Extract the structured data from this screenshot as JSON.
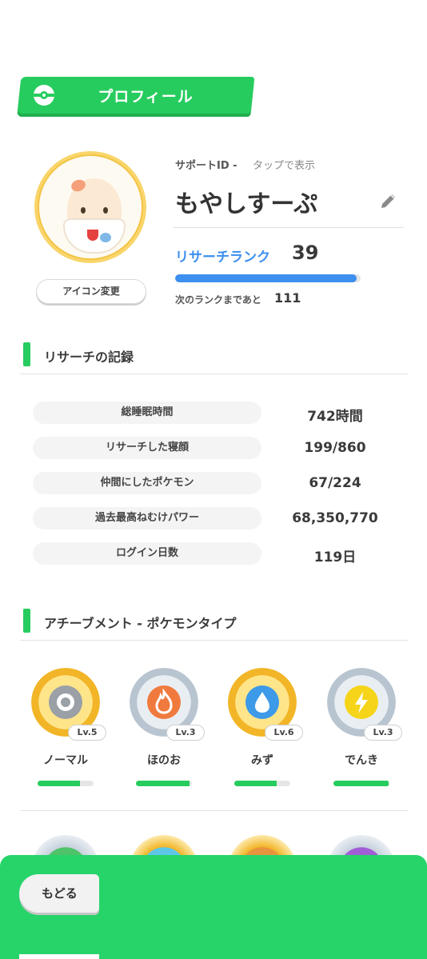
{
  "header": {
    "title": "プロフィール"
  },
  "profile": {
    "support_id_label": "サポートID -",
    "support_id_action": "タップで表示",
    "nickname": "もやしすーぷ",
    "icon_change_label": "アイコン変更",
    "rank_label": "リサーチランク",
    "rank_value": "39",
    "rank_progress": 0.98,
    "next_rank_label": "次のランクまであと",
    "next_rank_value": "111"
  },
  "research": {
    "title": "リサーチの記録",
    "stats": [
      {
        "label": "総睡眠時間",
        "value": "742時間"
      },
      {
        "label": "リサーチした寝顔",
        "value": "199/860"
      },
      {
        "label": "仲間にしたポケモン",
        "value": "67/224"
      },
      {
        "label": "過去最高ねむけパワー",
        "value": "68,350,770"
      },
      {
        "label": "ログイン日数",
        "value": "119日"
      }
    ]
  },
  "achievements": {
    "title": "アチーブメント - ポケモンタイプ",
    "types": [
      {
        "name": "ノーマル",
        "level": "Lv.5",
        "badge": "gold",
        "icon": "normal-type-icon",
        "color": "#9aa0a6",
        "progress": 0.75
      },
      {
        "name": "ほのお",
        "level": "Lv.3",
        "badge": "silver",
        "icon": "fire-type-icon",
        "color": "#f07a3e",
        "progress": 0.95
      },
      {
        "name": "みず",
        "level": "Lv.6",
        "badge": "gold",
        "icon": "water-type-icon",
        "color": "#3d9ae8",
        "progress": 0.75
      },
      {
        "name": "でんき",
        "level": "Lv.3",
        "badge": "silver",
        "icon": "electric-type-icon",
        "color": "#f5d419",
        "progress": 0.98
      }
    ]
  },
  "footer": {
    "back_label": "もどる"
  },
  "colors": {
    "accent_green": "#27cc5e",
    "rank_blue": "#3d8ff0"
  }
}
